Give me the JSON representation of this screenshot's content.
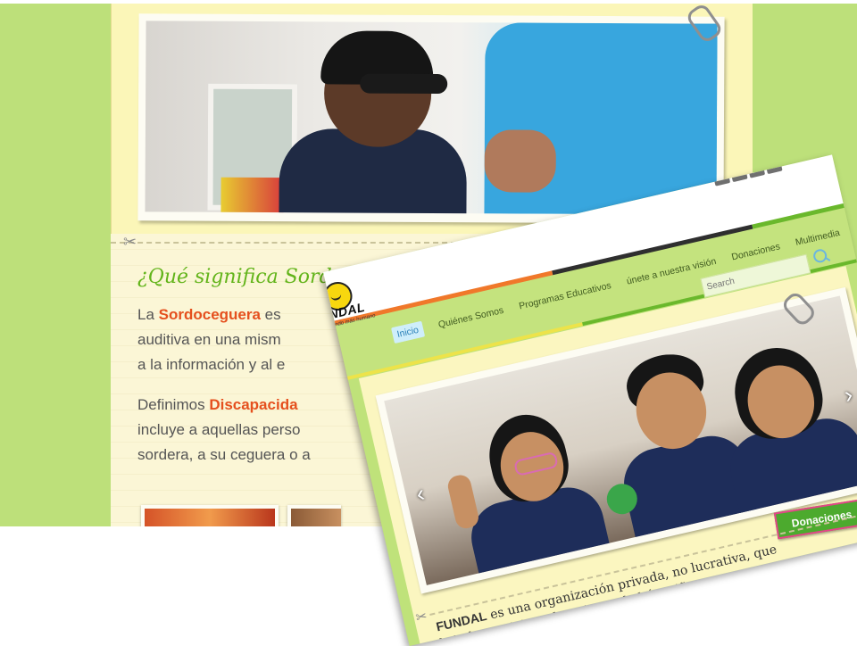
{
  "back_page": {
    "heading": "¿Qué significa Sordoc",
    "para1": {
      "line1_prefix": "La ",
      "line1_bold": "Sordoceguera",
      "line1_suffix": " es",
      "line2": "auditiva en una mism",
      "line3": "a la información y al e"
    },
    "para2": {
      "line1_prefix": "Definimos ",
      "line1_bold": "Discapacida",
      "line2": "incluye a aquellas perso",
      "line3": "sordera, a su ceguera o a"
    },
    "colors": {
      "background_green": "#bde07a",
      "paper": "#fbf6b8",
      "heading_green": "#62b41a",
      "highlight_orange": "#e5501e"
    }
  },
  "front_page": {
    "logo": {
      "name": "FUNDAL",
      "tagline": "Por un mundo más humano"
    },
    "social_icons": [
      {
        "icon": "facebook-icon",
        "glyph": "f"
      },
      {
        "icon": "twitter-icon",
        "glyph": "t"
      },
      {
        "icon": "youtube-icon",
        "glyph": "▶"
      },
      {
        "icon": "mail-icon",
        "glyph": "✉"
      }
    ],
    "nav": [
      {
        "label": "Inicio",
        "active": true
      },
      {
        "label": "Quiénes Somos",
        "active": false
      },
      {
        "label": "Programas Educativos",
        "active": false
      },
      {
        "label": "únete a nuestra visión",
        "active": false
      },
      {
        "label": "Donaciones",
        "active": false
      },
      {
        "label": "Multimedia",
        "active": false
      }
    ],
    "search": {
      "placeholder": "Search"
    },
    "donate_button": "Donaciones",
    "intro": {
      "line1_bold": "FUNDAL",
      "line1_rest": " es una organización privada, no lucrativa, que",
      "line2": "brinda servicios educativos a bebés, niñas,"
    },
    "colors": {
      "nav_active_bg": "#cfeefb",
      "donate_green": "#4caa2e",
      "donate_border": "#e34688"
    }
  }
}
